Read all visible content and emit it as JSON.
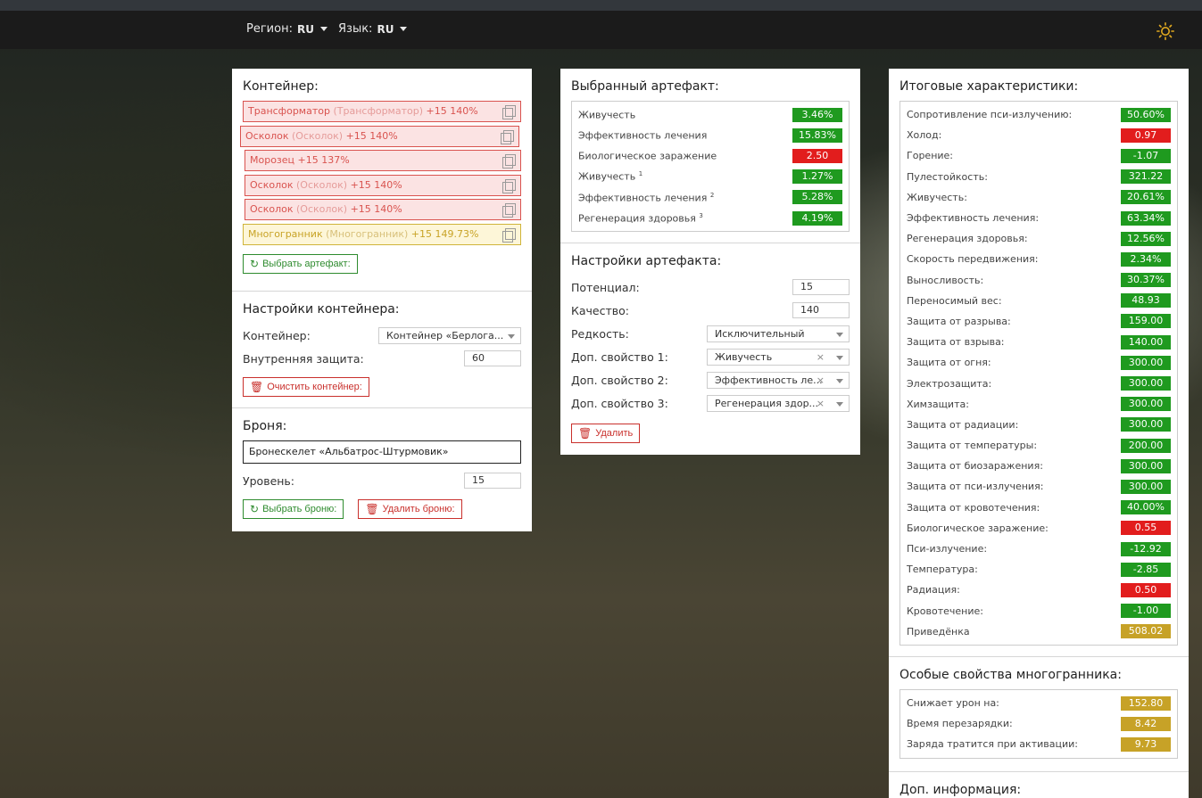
{
  "nav": {
    "region_label": "Регион:",
    "region_value": "RU",
    "lang_label": "Язык:",
    "lang_value": "RU"
  },
  "colors": {
    "good": "#1f9a1f",
    "bad": "#e21d1d",
    "special": "#c7a227",
    "artifact_border": "#d9534f"
  },
  "container": {
    "title": "Контейнер:",
    "artifacts": [
      {
        "name": "Трансформатор",
        "sub": " (Трансформатор)",
        "tail": " +15 140%",
        "kind": "red"
      },
      {
        "name": "Осколок",
        "sub": " (Осколок)",
        "tail": " +15 140%",
        "kind": "red"
      },
      {
        "name": "Морозец",
        "sub": "",
        "tail": " +15 137%",
        "kind": "red"
      },
      {
        "name": "Осколок",
        "sub": " (Осколок)",
        "tail": " +15 140%",
        "kind": "red"
      },
      {
        "name": "Осколок",
        "sub": " (Осколок)",
        "tail": " +15 140%",
        "kind": "red"
      },
      {
        "name": "Многогранник",
        "sub": " (Многогранник)",
        "tail": " +15 149.73%",
        "kind": "gold"
      }
    ],
    "select_button": "Выбрать артефакт:"
  },
  "container_settings": {
    "title": "Настройки контейнера:",
    "container_label": "Контейнер:",
    "container_value": "Контейнер «Берлога...",
    "inner_protection_label": "Внутренняя защита:",
    "inner_protection_value": "60",
    "clear_button": "Очистить контейнер:"
  },
  "armor": {
    "title": "Броня:",
    "name": "Бронескелет «Альбатрос-Штурмовик»",
    "level_label": "Уровень:",
    "level_value": "15",
    "select_button": "Выбрать броню:",
    "delete_button": "Удалить броню:"
  },
  "selected_artifact": {
    "title": "Выбранный артефакт:",
    "stats": [
      {
        "label": "Живучесть",
        "sup": "",
        "value": "3.46%",
        "color": "g"
      },
      {
        "label": "Эффективность лечения",
        "sup": "",
        "value": "15.83%",
        "color": "g"
      },
      {
        "label": "Биологическое заражение",
        "sup": "",
        "value": "2.50",
        "color": "r"
      },
      {
        "label": "Живучесть",
        "sup": "1",
        "value": "1.27%",
        "color": "g"
      },
      {
        "label": "Эффективность лечения",
        "sup": "2",
        "value": "5.28%",
        "color": "g"
      },
      {
        "label": "Регенерация здоровья",
        "sup": "3",
        "value": "4.19%",
        "color": "g"
      }
    ]
  },
  "artifact_settings": {
    "title": "Настройки артефакта:",
    "potential_label": "Потенциал:",
    "potential_value": "15",
    "quality_label": "Качество:",
    "quality_value": "140",
    "rarity_label": "Редкость:",
    "rarity_value": "Исключительный",
    "extra1_label": "Доп. свойство 1:",
    "extra1_value": "Живучесть",
    "extra2_label": "Доп. свойство 2:",
    "extra2_value": "Эффективность ле...",
    "extra3_label": "Доп. свойство 3:",
    "extra3_value": "Регенерация здор...",
    "clear_symbol": "×",
    "delete_button": "Удалить"
  },
  "totals": {
    "title": "Итоговые характеристики:",
    "stats": [
      {
        "label": "Сопротивление пси-излучению:",
        "value": "50.60%",
        "color": "g"
      },
      {
        "label": "Холод:",
        "value": "0.97",
        "color": "r"
      },
      {
        "label": "Горение:",
        "value": "-1.07",
        "color": "g"
      },
      {
        "label": "Пулестойкость:",
        "value": "321.22",
        "color": "g"
      },
      {
        "label": "Живучесть:",
        "value": "20.61%",
        "color": "g"
      },
      {
        "label": "Эффективность лечения:",
        "value": "63.34%",
        "color": "g"
      },
      {
        "label": "Регенерация здоровья:",
        "value": "12.56%",
        "color": "g"
      },
      {
        "label": "Скорость передвижения:",
        "value": "2.34%",
        "color": "g"
      },
      {
        "label": "Выносливость:",
        "value": "30.37%",
        "color": "g"
      },
      {
        "label": "Переносимый вес:",
        "value": "48.93",
        "color": "g"
      },
      {
        "label": "Защита от разрыва:",
        "value": "159.00",
        "color": "g"
      },
      {
        "label": "Защита от взрыва:",
        "value": "140.00",
        "color": "g"
      },
      {
        "label": "Защита от огня:",
        "value": "300.00",
        "color": "g"
      },
      {
        "label": "Электрозащита:",
        "value": "300.00",
        "color": "g"
      },
      {
        "label": "Химзащита:",
        "value": "300.00",
        "color": "g"
      },
      {
        "label": "Защита от радиации:",
        "value": "300.00",
        "color": "g"
      },
      {
        "label": "Защита от температуры:",
        "value": "200.00",
        "color": "g"
      },
      {
        "label": "Защита от биозаражения:",
        "value": "300.00",
        "color": "g"
      },
      {
        "label": "Защита от пси-излучения:",
        "value": "300.00",
        "color": "g"
      },
      {
        "label": "Защита от кровотечения:",
        "value": "40.00%",
        "color": "g"
      },
      {
        "label": "Биологическое заражение:",
        "value": "0.55",
        "color": "r"
      },
      {
        "label": "Пси-излучение:",
        "value": "-12.92",
        "color": "g"
      },
      {
        "label": "Температура:",
        "value": "-2.85",
        "color": "g"
      },
      {
        "label": "Радиация:",
        "value": "0.50",
        "color": "r"
      },
      {
        "label": "Кровотечение:",
        "value": "-1.00",
        "color": "g"
      },
      {
        "label": "Приведёнка",
        "value": "508.02",
        "color": "y"
      }
    ]
  },
  "polyhedron": {
    "title": "Особые свойства многогранника:",
    "stats": [
      {
        "label": "Снижает урон на:",
        "value": "152.80",
        "color": "y"
      },
      {
        "label": "Время перезарядки:",
        "value": "8.42",
        "color": "y"
      },
      {
        "label": "Заряда тратится при активации:",
        "value": "9.73",
        "color": "y"
      }
    ]
  },
  "extra_info": {
    "title": "Доп. информация:"
  }
}
